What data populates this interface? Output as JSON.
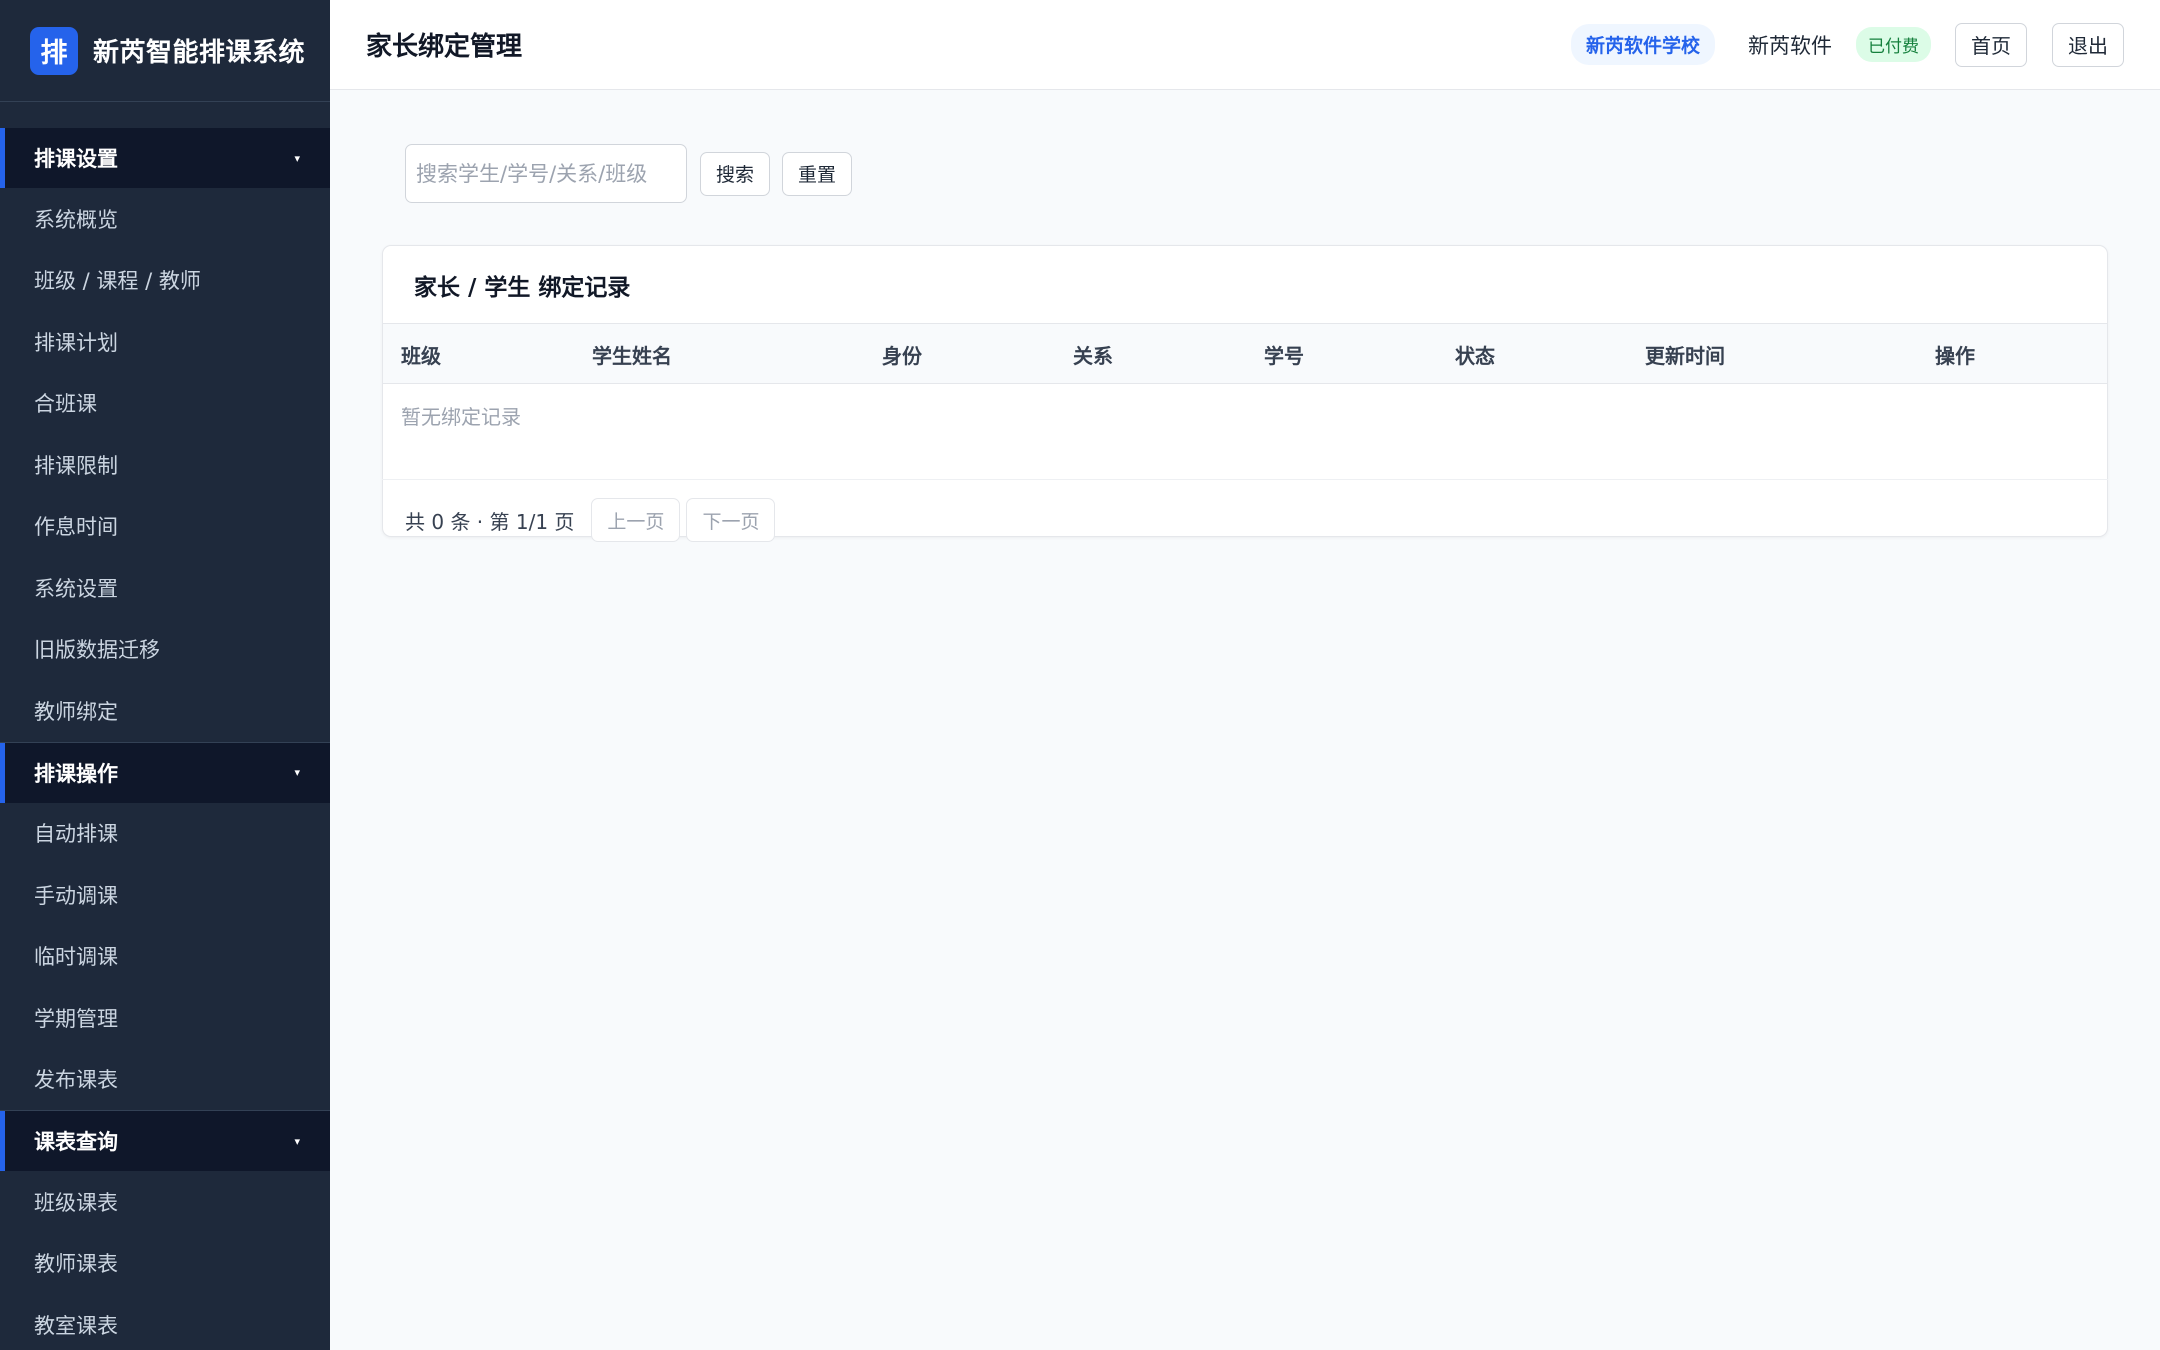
{
  "brand": {
    "logo_char": "排",
    "name": "新芮智能排课系统"
  },
  "sidebar": {
    "groups": [
      {
        "label": "排课设置",
        "items": [
          "系统概览",
          "班级 / 课程 / 教师",
          "排课计划",
          "合班课",
          "排课限制",
          "作息时间",
          "系统设置",
          "旧版数据迁移",
          "教师绑定"
        ]
      },
      {
        "label": "排课操作",
        "items": [
          "自动排课",
          "手动调课",
          "临时调课",
          "学期管理",
          "发布课表"
        ]
      },
      {
        "label": "课表查询",
        "items": [
          "班级课表",
          "教师课表",
          "教室课表"
        ]
      }
    ],
    "caret": "▾"
  },
  "header": {
    "title": "家长绑定管理",
    "school": "新芮软件学校",
    "user": "新芮软件",
    "paid_badge": "已付费",
    "home_button": "首页",
    "logout_button": "退出"
  },
  "toolbar": {
    "search_placeholder": "搜索学生/学号/关系/班级",
    "search_value": "",
    "search_button": "搜索",
    "reset_button": "重置"
  },
  "table": {
    "title": "家长 / 学生 绑定记录",
    "columns": [
      "班级",
      "学生姓名",
      "身份",
      "关系",
      "学号",
      "状态",
      "更新时间",
      "操作"
    ],
    "empty_text": "暂无绑定记录"
  },
  "pagination": {
    "info": "共 0 条 · 第 1/1 页",
    "prev": "上一页",
    "next": "下一页"
  },
  "colors": {
    "sidebar_bg": "#1e293b",
    "sidebar_group_bg": "#0f172a",
    "accent": "#2563eb",
    "paid_green": "#15803d"
  }
}
